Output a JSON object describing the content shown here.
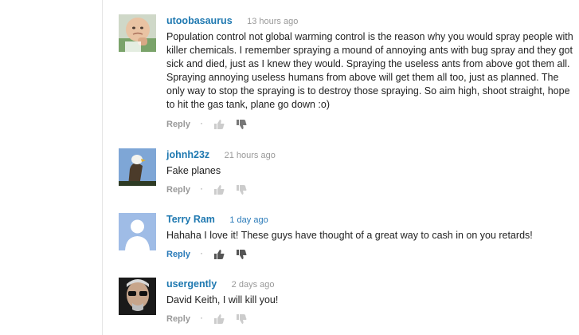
{
  "comments": [
    {
      "author": "utoobasaurus",
      "time": "13 hours ago",
      "time_is_link": false,
      "text": "Population control not global warming control is the reason why you would spray people with killer chemicals. I remember spraying a mound of annoying ants with bug spray and they got sick and died, just as I knew they would. Spraying the useless ants from above got them all. Spraying annoying useless humans from above will get them all too, just as planned. The only way to stop the spraying is to destroy those spraying. So aim high, shoot straight, hope to hit the gas tank, plane go down :o)",
      "reply_label": "Reply",
      "separator": "·",
      "thumbs_active": false,
      "avatar_icon": "baby-fist-avatar"
    },
    {
      "author": "johnh23z",
      "time": "21 hours ago",
      "time_is_link": false,
      "text": "Fake planes",
      "reply_label": "Reply",
      "separator": "·",
      "thumbs_active": false,
      "avatar_icon": "eagle-avatar"
    },
    {
      "author": "Terry Ram",
      "time": "1 day ago",
      "time_is_link": true,
      "text": "Hahaha I love it! These guys have thought of a great way to cash in on you retards!",
      "reply_label": "Reply",
      "separator": "·",
      "thumbs_active": true,
      "avatar_icon": "default-silhouette-avatar"
    },
    {
      "author": "usergently",
      "time": "2 days ago",
      "time_is_link": false,
      "text": "David Keith, I will kill you!",
      "reply_label": "Reply",
      "separator": "·",
      "thumbs_active": false,
      "avatar_icon": "man-sunglasses-avatar"
    }
  ],
  "colors": {
    "author_link": "#1e78b0",
    "timestamp": "#999999",
    "timestamp_link": "#2b7bb9",
    "text": "#222222",
    "divider": "#e5e5e5",
    "thumb_inactive": "#cccccc",
    "thumb_active": "#555555"
  }
}
